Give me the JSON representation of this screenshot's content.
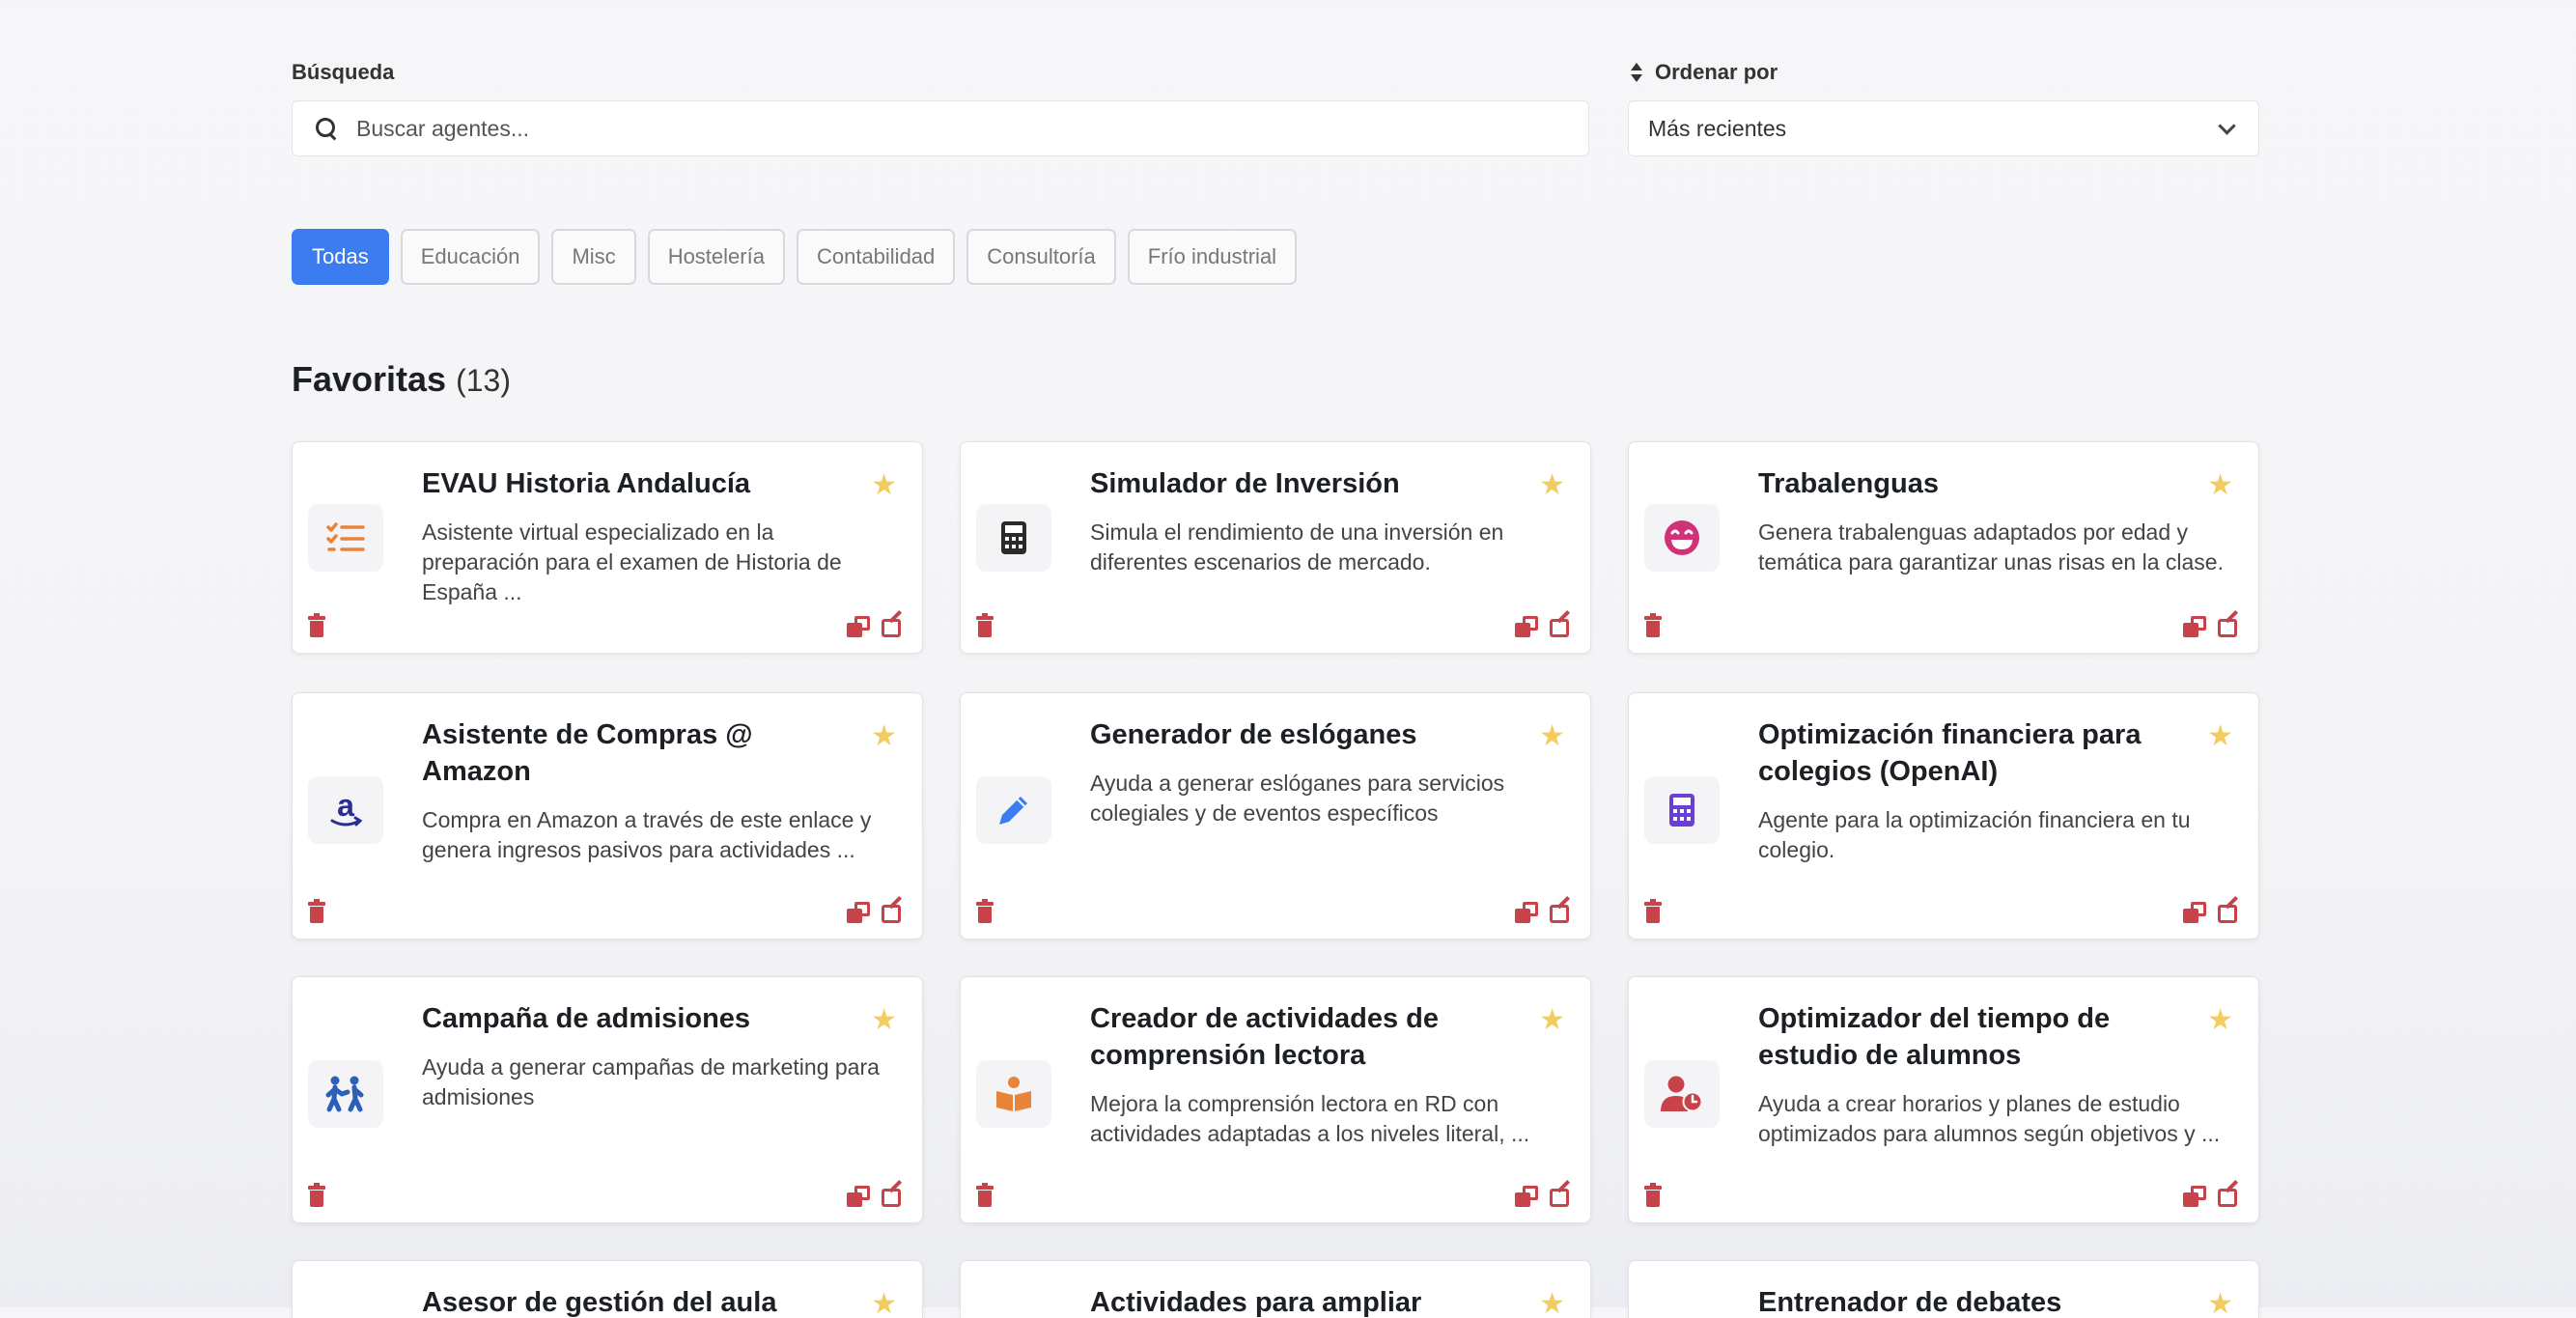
{
  "search": {
    "label": "Búsqueda",
    "placeholder": "Buscar agentes..."
  },
  "sort": {
    "label": "Ordenar por",
    "selected": "Más recientes"
  },
  "categories": [
    "Todas",
    "Educación",
    "Misc",
    "Hostelería",
    "Contabilidad",
    "Consultoría",
    "Frío industrial"
  ],
  "active_category": "Todas",
  "section": {
    "title": "Favoritas",
    "count": "(13)"
  },
  "cards": [
    {
      "title": "EVAU Historia Andalucía",
      "desc": "Asistente virtual especializado en la preparación para el examen de Historia de España ...",
      "icon": "list-check-icon",
      "icon_color": "#e8843a"
    },
    {
      "title": "Simulador de Inversión",
      "desc": "Simula el rendimiento de una inversión en diferentes escenarios de mercado.",
      "icon": "calculator-icon",
      "icon_color": "#2b2b2b"
    },
    {
      "title": "Trabalenguas",
      "desc": "Genera trabalenguas adaptados por edad y temática para garantizar unas risas en la clase.",
      "icon": "laughing-face-icon",
      "icon_color": "#d0327a"
    },
    {
      "title": "Asistente de Compras @ Amazon",
      "desc": "Compra en Amazon a través de este enlace y genera ingresos pasivos para actividades ...",
      "icon": "amazon-icon",
      "icon_color": "#2a2f8f"
    },
    {
      "title": "Generador de eslóganes",
      "desc": "Ayuda a generar eslóganes para servicios colegiales y de eventos específicos",
      "icon": "pencil-icon",
      "icon_color": "#3b7cf0"
    },
    {
      "title": "Optimización financiera para colegios (OpenAI)",
      "desc": "Agente para la optimización financiera en tu colegio.",
      "icon": "calculator-icon",
      "icon_color": "#6a3fd1"
    },
    {
      "title": "Campaña de admisiones",
      "desc": "Ayuda a generar campañas de marketing para admisiones",
      "icon": "people-walking-icon",
      "icon_color": "#2e5fb8"
    },
    {
      "title": "Creador de actividades de comprensión lectora",
      "desc": "Mejora la comprensión lectora en RD con actividades adaptadas a los niveles literal, ...",
      "icon": "book-reader-icon",
      "icon_color": "#e8843a"
    },
    {
      "title": "Optimizador del tiempo de estudio de alumnos",
      "desc": "Ayuda a crear horarios y planes de estudio optimizados para alumnos según objetivos y ...",
      "icon": "user-clock-icon",
      "icon_color": "#c8424a"
    },
    {
      "title": "Asesor de gestión del aula",
      "desc": "",
      "icon": "",
      "icon_color": ""
    },
    {
      "title": "Actividades para ampliar",
      "desc": "",
      "icon": "",
      "icon_color": ""
    },
    {
      "title": "Entrenador de debates",
      "desc": "",
      "icon": "",
      "icon_color": ""
    }
  ],
  "colors": {
    "accent": "#3b7cf0",
    "star": "#f2cc5e",
    "danger": "#c8424a"
  }
}
